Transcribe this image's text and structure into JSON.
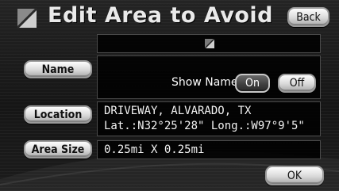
{
  "header": {
    "title": "Edit Area to Avoid",
    "back_label": "Back",
    "icon": "area-avoid-icon"
  },
  "name_field": {
    "button_label": "Name",
    "show_name_label": "Show Name",
    "on_label": "On",
    "off_label": "Off",
    "selected": "On"
  },
  "location": {
    "button_label": "Location",
    "place": "DRIVEWAY, ALVARADO, TX",
    "coords": "Lat.:N32°25'28\" Long.:W97°9'5\""
  },
  "area_size": {
    "button_label": "Area Size",
    "value": "0.25mi X 0.25mi"
  },
  "footer": {
    "ok_label": "OK"
  },
  "colors": {
    "background": "#1b1b1b",
    "button_face": "#d9d9d9",
    "button_active": "#3d3d3d",
    "panel": "#000000"
  }
}
